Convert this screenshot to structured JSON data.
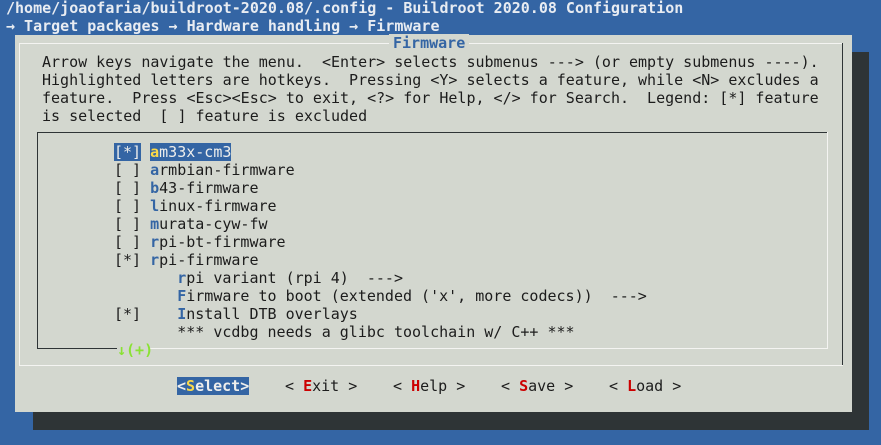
{
  "window_title": "/home/joaofaria/buildroot-2020.08/.config - Buildroot 2020.08 Configuration",
  "breadcrumb": "→ Target packages → Hardware handling → Firmware",
  "dialog": {
    "title": "Firmware",
    "help_lines": [
      "Arrow keys navigate the menu.  <Enter> selects submenus ---> (or empty submenus ----).",
      "Highlighted letters are hotkeys.  Pressing <Y> selects a feature, while <N> excludes a",
      "feature.  Press <Esc><Esc> to exit, <?> for Help, </> for Search.  Legend: [*] feature",
      "is selected  [ ] feature is excluded"
    ]
  },
  "menu": {
    "items": [
      {
        "box": "[*]",
        "pre": "",
        "hotkey": "a",
        "rest": "m33x-cm3"
      },
      {
        "box": "[ ]",
        "pre": "",
        "hotkey": "a",
        "rest": "rmbian-firmware"
      },
      {
        "box": "[ ]",
        "pre": "",
        "hotkey": "b",
        "rest": "43-firmware"
      },
      {
        "box": "[ ]",
        "pre": "",
        "hotkey": "l",
        "rest": "inux-firmware"
      },
      {
        "box": "[ ]",
        "pre": "",
        "hotkey": "m",
        "rest": "urata-cyw-fw"
      },
      {
        "box": "[ ]",
        "pre": "",
        "hotkey": "r",
        "rest": "pi-bt-firmware"
      },
      {
        "box": "[*]",
        "pre": "",
        "hotkey": "r",
        "rest": "pi-firmware"
      },
      {
        "box": "   ",
        "pre": "   ",
        "hotkey": "r",
        "rest": "pi variant (rpi 4)  --->"
      },
      {
        "box": "   ",
        "pre": "   ",
        "hotkey": "F",
        "rest": "irmware to boot (extended ('x', more codecs))  --->"
      },
      {
        "box": "[*]",
        "pre": "   ",
        "hotkey": "I",
        "rest": "nstall DTB overlays"
      },
      {
        "box": "   ",
        "pre": "   ",
        "hotkey": "",
        "rest": "*** vcdbg needs a glibc toolchain w/ C++ ***"
      }
    ],
    "more_indicator": "↓(+)"
  },
  "buttons": {
    "select": {
      "pre": "<",
      "key": "S",
      "rest": "elect>"
    },
    "exit": {
      "pre": "< ",
      "key": "E",
      "rest": "xit >"
    },
    "help": {
      "pre": "< ",
      "key": "H",
      "rest": "elp >"
    },
    "save": {
      "pre": "< ",
      "key": "S",
      "rest": "ave >"
    },
    "load": {
      "pre": "< ",
      "key": "L",
      "rest": "oad >"
    }
  }
}
